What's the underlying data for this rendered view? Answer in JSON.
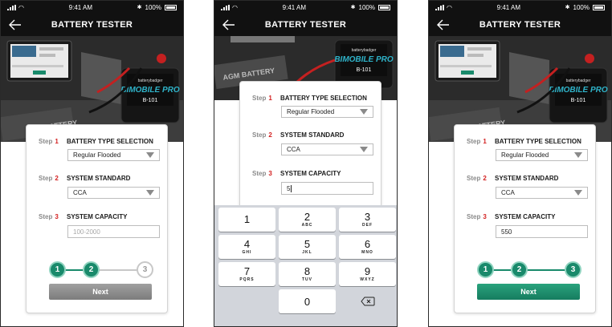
{
  "status": {
    "time": "9:41 AM",
    "battery": "100%"
  },
  "nav": {
    "title": "BATTERY TESTER"
  },
  "form": {
    "step_word": "Step",
    "steps": [
      {
        "num": "1",
        "heading": "BATTERY TYPE SELECTION"
      },
      {
        "num": "2",
        "heading": "SYSTEM STANDARD"
      },
      {
        "num": "3",
        "heading": "SYSTEM CAPACITY"
      }
    ],
    "battery_type_value": "Regular Flooded",
    "standard_value": "CCA",
    "capacity_placeholder": "100-2000",
    "next_label": "Next"
  },
  "screens": [
    {
      "capacity_value": "",
      "progress": [
        "1",
        "2",
        "3"
      ],
      "progress_done": 2
    },
    {
      "capacity_value": "5"
    },
    {
      "capacity_value": "550",
      "progress": [
        "1",
        "2",
        "3"
      ],
      "progress_done": 3
    }
  ],
  "keypad": {
    "keys": [
      {
        "n": "1",
        "l": ""
      },
      {
        "n": "2",
        "l": "ABC"
      },
      {
        "n": "3",
        "l": "DEF"
      },
      {
        "n": "4",
        "l": "GHI"
      },
      {
        "n": "5",
        "l": "JKL"
      },
      {
        "n": "6",
        "l": "MNO"
      },
      {
        "n": "7",
        "l": "PQRS"
      },
      {
        "n": "8",
        "l": "TUV"
      },
      {
        "n": "9",
        "l": "WXYZ"
      },
      {
        "n": "0",
        "l": ""
      }
    ]
  },
  "hero": {
    "device_brand": "batterybadger",
    "device_name": "BIMOBILE PRO",
    "device_model": "B-101",
    "banner": "AGM BATTERY"
  },
  "colors": {
    "accent": "#198a6b",
    "step_red": "#d31f1f",
    "bar": "#111111"
  }
}
